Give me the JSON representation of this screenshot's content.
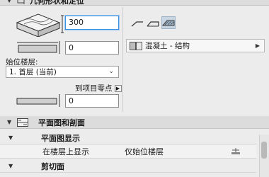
{
  "geometry_panel": {
    "title": "几何形状和定位",
    "height_value": "300",
    "offset_value": "0",
    "home_story_label": "始位楼层:",
    "home_story_value": "1. 首层 (当前)",
    "to_project_zero_label": "到项目零点",
    "project_zero_value": "0"
  },
  "material": {
    "label": "混凝土 - 结构"
  },
  "plan_section_panel": {
    "title": "平面图和剖面",
    "floor_plan_display": {
      "title": "平面图显示",
      "show_on_stories_label": "在楼层上显示",
      "show_on_stories_value": "仅始位楼层"
    },
    "cut_surfaces": {
      "title": "剪切面"
    }
  },
  "icons": [
    "collapse-triangle-icon",
    "geometry-icon",
    "slab-3d-icon",
    "slab-plan-icon",
    "edge-style-icon",
    "material-swatch-icon",
    "submenu-arrow-icon",
    "chevron-down-icon",
    "plan-section-icon",
    "story-display-icon"
  ],
  "colors": {
    "focus_border": "#3b8fe0",
    "active_toggle": "#c8d6e4",
    "header_bg": "#dcdcdc"
  }
}
